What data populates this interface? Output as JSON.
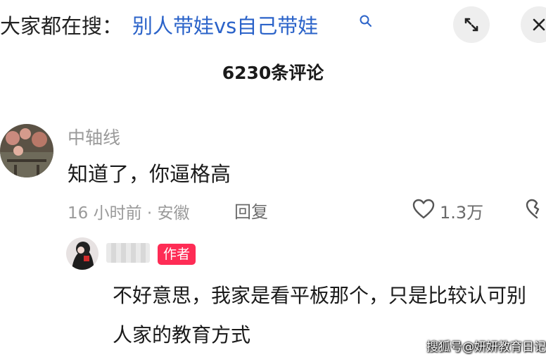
{
  "search": {
    "prefix": "大家都在搜：",
    "query": "别人带娃vs自己带娃"
  },
  "comments": {
    "count_label": "6230条评论"
  },
  "comment": {
    "username": "中轴线",
    "text": "知道了，你逼格高",
    "time_location": "16 小时前 · 安徽",
    "reply_label": "回复",
    "like_count": "1.3万"
  },
  "reply": {
    "author_badge": "作者",
    "text": "不好意思，我家是看平板那个，只是比较认可别人家的教育方式"
  },
  "watermark": "搜狐号@妍妍教育日记",
  "colors": {
    "accent_link": "#2b63c9",
    "author_badge": "#fe2c55",
    "muted_text": "#9a9a9a"
  },
  "icons": [
    "search-icon",
    "expand-icon",
    "close-icon",
    "heart-icon",
    "broken-heart-icon"
  ]
}
